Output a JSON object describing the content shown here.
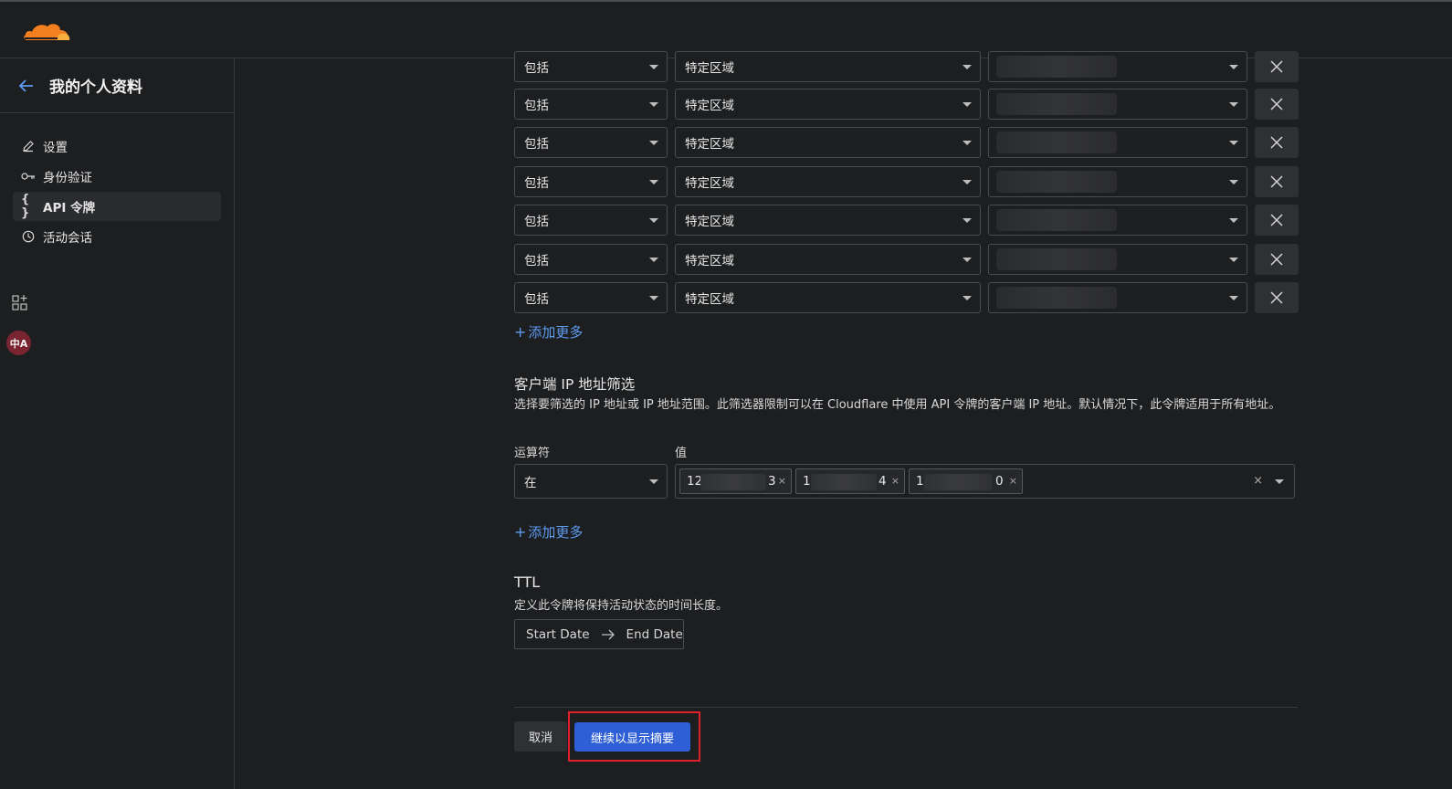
{
  "header": {
    "logo_icon": "cloudflare-logo-icon"
  },
  "sidebar": {
    "title": "我的个人资料",
    "back_icon": "arrow-left-icon",
    "items": [
      {
        "label": "设置",
        "icon": "pencil-icon",
        "active": false
      },
      {
        "label": "身份验证",
        "icon": "key-icon",
        "active": false
      },
      {
        "label": "API 令牌",
        "icon": "braces-icon",
        "active": true
      },
      {
        "label": "活动会话",
        "icon": "clock-icon",
        "active": false
      }
    ],
    "lang_badge": "中A"
  },
  "zone_rows": [
    {
      "include": "包括",
      "scope": "特定区域"
    },
    {
      "include": "包括",
      "scope": "特定区域"
    },
    {
      "include": "包括",
      "scope": "特定区域"
    },
    {
      "include": "包括",
      "scope": "特定区域"
    },
    {
      "include": "包括",
      "scope": "特定区域"
    },
    {
      "include": "包括",
      "scope": "特定区域"
    },
    {
      "include": "包括",
      "scope": "特定区域"
    }
  ],
  "add_more_label": "添加更多",
  "ip_filter": {
    "title": "客户端 IP 地址筛选",
    "description": "选择要筛选的 IP 地址或 IP 地址范围。此筛选器限制可以在 Cloudflare 中使用 API 令牌的客户端 IP 地址。默认情况下，此令牌适用于所有地址。",
    "operator_label": "运算符",
    "value_label": "值",
    "operator_value": "在",
    "chips": [
      {
        "start": "12",
        "end": "3"
      },
      {
        "start": "1",
        "end": "4"
      },
      {
        "start": "1",
        "end": "0"
      }
    ]
  },
  "ttl": {
    "title": "TTL",
    "description": "定义此令牌将保持活动状态的时间长度。",
    "start_placeholder": "Start Date",
    "end_placeholder": "End Date"
  },
  "actions": {
    "cancel_label": "取消",
    "continue_label": "继续以显示摘要"
  },
  "colors": {
    "accent": "#2f5fd6",
    "link": "#5d9cf0",
    "highlight": "#e0202a",
    "background": "#1d1e20"
  }
}
